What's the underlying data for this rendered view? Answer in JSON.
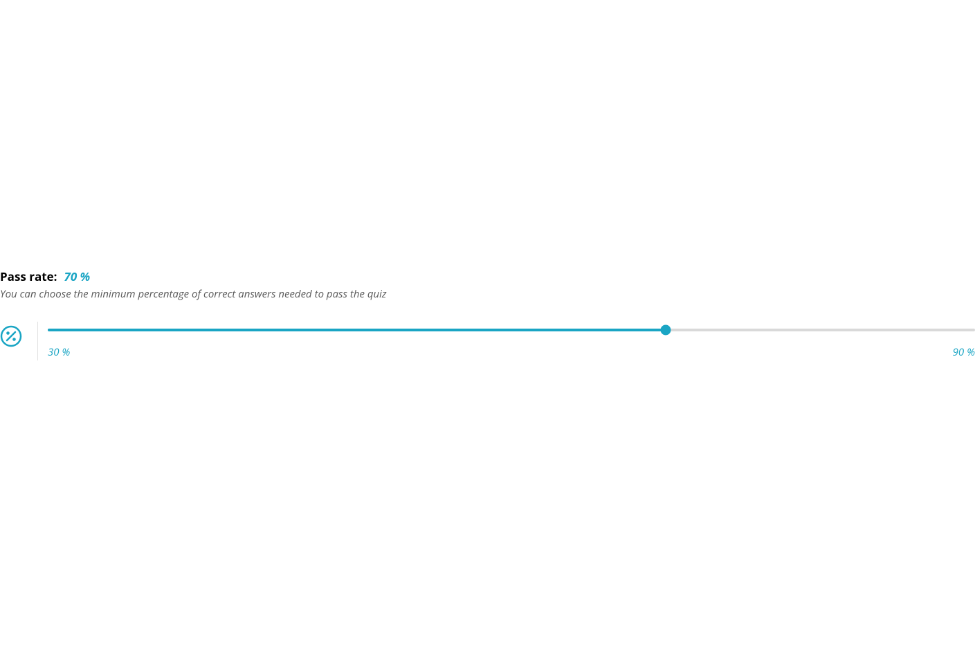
{
  "passRate": {
    "label": "Pass rate:",
    "value": "70 %",
    "description": "You can choose the minimum percentage of correct answers needed to pass the quiz",
    "slider": {
      "min": 30,
      "max": 90,
      "current": 70,
      "minLabel": "30 %",
      "maxLabel": "90 %",
      "fillPercent": "66.67%"
    }
  },
  "colors": {
    "accent": "#1aa5c4"
  }
}
